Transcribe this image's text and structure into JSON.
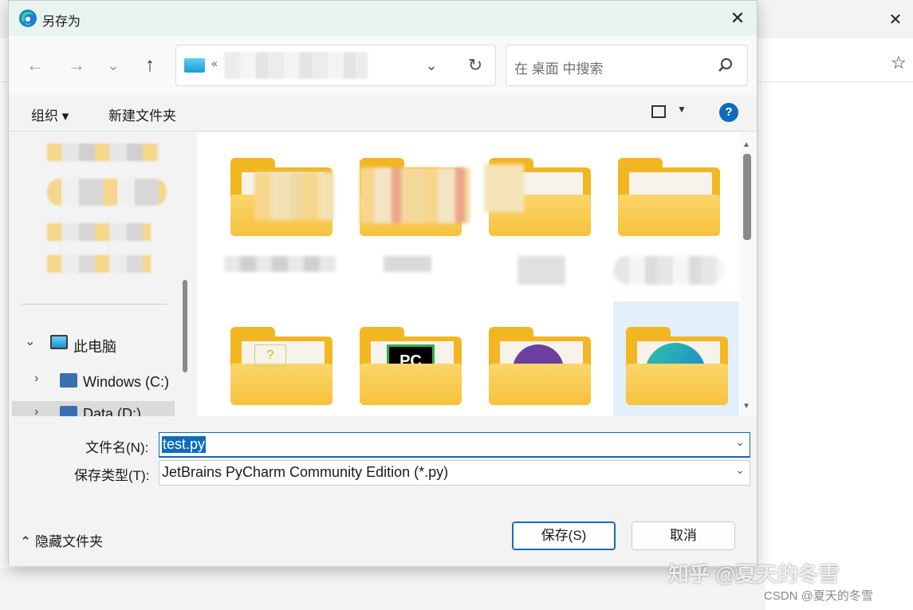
{
  "dialog": {
    "title": "另存为"
  },
  "nav": {
    "back_icon": "←",
    "forward_icon": "→",
    "recent_icon": "⌄",
    "up_icon": "↑",
    "address_chevron": "«",
    "address_dropdown": "⌄",
    "refresh_icon": "↻"
  },
  "search": {
    "placeholder": "在 桌面 中搜索"
  },
  "commandbar": {
    "organize": "组织 ▾",
    "new_folder": "新建文件夹",
    "help": "?"
  },
  "sidebar": {
    "this_pc": "此电脑",
    "drive_c": "Windows (C:)",
    "drive_d": "Data (D:)"
  },
  "files": {
    "pc_logo_text": "PC"
  },
  "form": {
    "filename_label": "文件名(N):",
    "filename_value": "test.py",
    "filetype_label": "保存类型(T):",
    "filetype_value": "JetBrains PyCharm Community Edition (*.py)"
  },
  "footer": {
    "hide_folders": "隐藏文件夹",
    "save": "保存(S)",
    "cancel": "取消"
  },
  "watermark": {
    "zhihu": "知乎 @夏天的冬雪",
    "csdn": "CSDN @夏天的冬雪"
  },
  "colors": {
    "accent": "#0f6cbd",
    "folder": "#f3b623",
    "titlebar": "#e9f3ef"
  }
}
